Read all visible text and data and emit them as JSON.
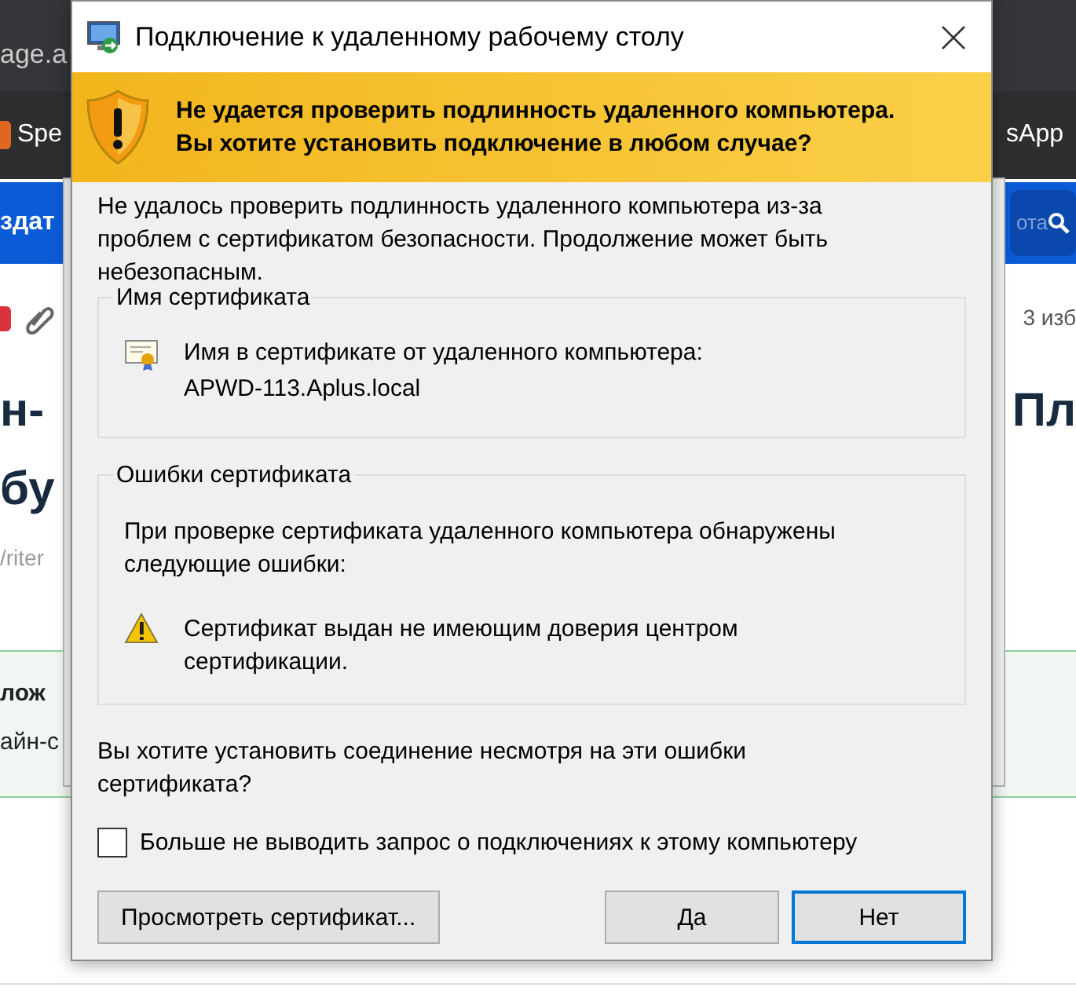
{
  "background": {
    "address_bar": "age.a",
    "bookmarks": [
      "Spe",
      "sApp"
    ],
    "site_header": {
      "left_text": "здат",
      "search_text": "ота"
    },
    "favorites_link": "3 изб",
    "heading_lines": [
      "н-",
      "бу"
    ],
    "heading_right": "Пл",
    "byline": "/riter",
    "notice": {
      "title": "лож",
      "text": "айн-с"
    }
  },
  "dialog": {
    "title": "Подключение к удаленному рабочему столу",
    "warning": "Не удается проверить подлинность удаленного компьютера. Вы хотите установить подключение в любом случае?",
    "intro": "Не удалось проверить подлинность удаленного компьютера из-за проблем с сертификатом безопасности. Продолжение может быть небезопасным.",
    "groups": [
      {
        "legend": "Имя сертификата",
        "kind": "certificate",
        "lines": [
          "Имя в сертификате от удаленного компьютера:",
          "APWD-113.Aplus.local"
        ]
      },
      {
        "legend": "Ошибки сертификата",
        "kind": "errors",
        "text": "При проверке сертификата удаленного компьютера обнаружены следующие ошибки:",
        "errors": [
          "Сертификат выдан не имеющим доверия центром сертификации."
        ]
      }
    ],
    "question": "Вы хотите установить соединение несмотря на эти ошибки сертификата?",
    "checkbox": {
      "label": "Больше не выводить запрос о подключениях к этому компьютеру",
      "checked": false
    },
    "buttons": [
      {
        "label": "Просмотреть сертификат...",
        "default": false
      },
      {
        "label": "Да",
        "default": false
      },
      {
        "label": "Нет",
        "default": true
      }
    ]
  }
}
